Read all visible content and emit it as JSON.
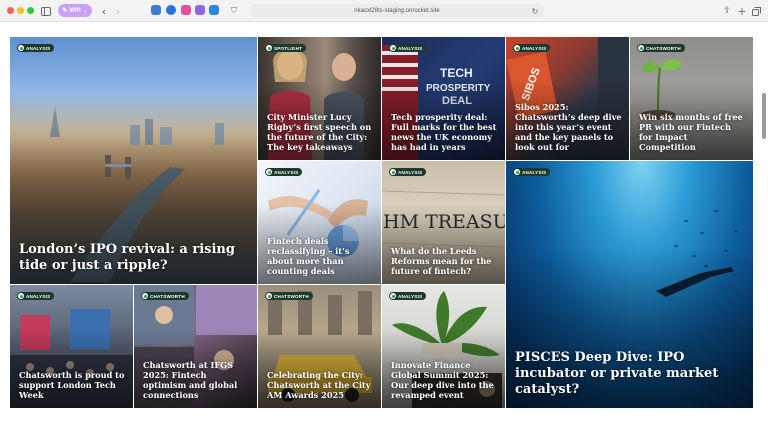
{
  "browser": {
    "wip_label": "WIP",
    "url": "nkacxl28ts-staging.onrocket.site"
  },
  "colors": {
    "badge_bg": "#1d3b2d",
    "badge_dot": "#2e9b5e",
    "wip_pill": "#c9a2f5"
  },
  "tiles": [
    {
      "badge": "ANALYSIS",
      "title": "London’s IPO revival: a rising tide or just a ripple?"
    },
    {
      "badge": "SPOTLIGHT",
      "title": "City Minister Lucy Rigby’s first speech on the future of the City: The key takeaways"
    },
    {
      "badge": "ANALYSIS",
      "title": "Tech prosperity deal: Full marks for the best news the UK economy has had in years"
    },
    {
      "badge": "ANALYSIS",
      "title": "Sibos 2025: Chatsworth’s deep dive into this year’s event and the key panels to look out for"
    },
    {
      "badge": "CHATSWORTH",
      "title": "Win six months of free PR with our Fintech for Impact Competition"
    },
    {
      "badge": "ANALYSIS",
      "title": "Fintech deals reclassifying – it’s about more than counting deals"
    },
    {
      "badge": "ANALYSIS",
      "title": "What do the Leeds Reforms mean for the future of fintech?"
    },
    {
      "badge": "ANALYSIS",
      "title": "PISCES Deep Dive: IPO incubator or private market catalyst?"
    },
    {
      "badge": "ANALYSIS",
      "title": "Chatsworth is proud to support London Tech Week"
    },
    {
      "badge": "CHATSWORTH",
      "title": "Chatsworth at IFGS 2025: Fintech optimism and global connections"
    },
    {
      "badge": "CHATSWORTH",
      "title": "Celebrating the City: Chatsworth at the City AM Awards 2025"
    },
    {
      "badge": "ANALYSIS",
      "title": "Innovate Finance Global Summit 2025: Our deep dive into the revamped event"
    }
  ]
}
